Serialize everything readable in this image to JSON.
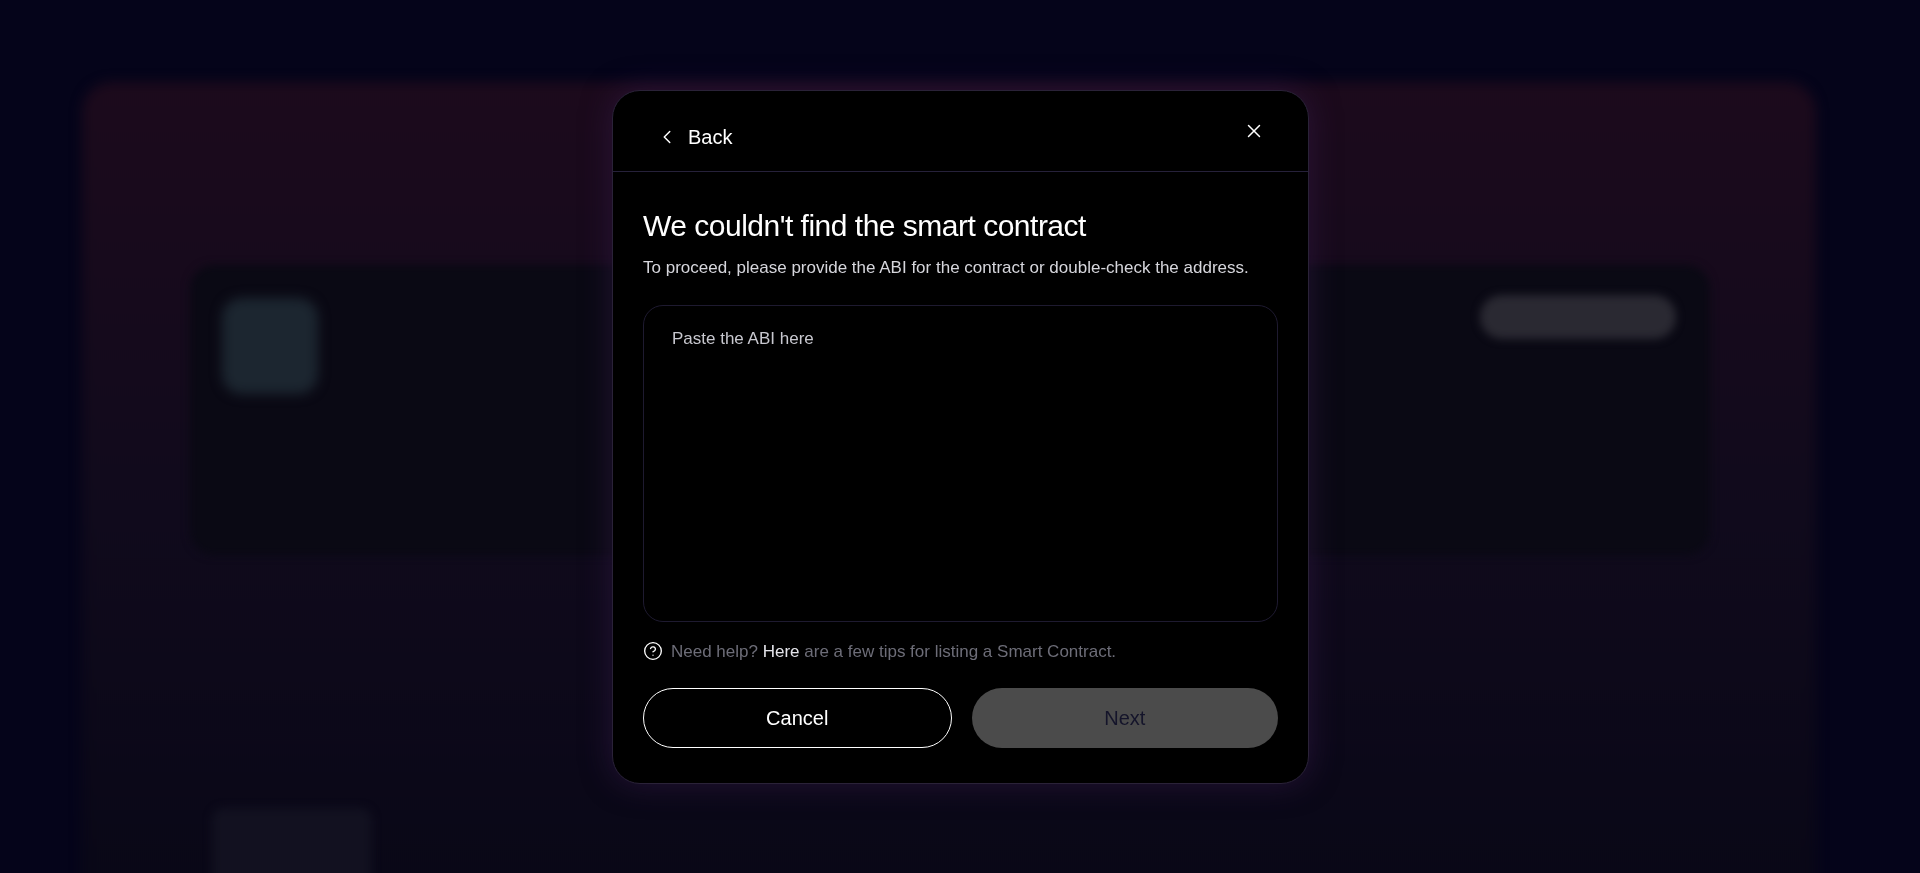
{
  "dialog": {
    "back": {
      "label": "Back"
    },
    "title": "We couldn't find the smart contract",
    "subtitle": "To proceed, please provide the ABI for the contract or double-check the address.",
    "abi_field": {
      "placeholder": "Paste the ABI here"
    },
    "help": {
      "prefix": "Need help?",
      "link": "Here",
      "suffix": "are a few tips for listing a Smart Contract."
    },
    "buttons": [
      {
        "label": "Cancel",
        "kind": "secondary",
        "disabled": false
      },
      {
        "label": "Next",
        "kind": "primary",
        "disabled": true
      }
    ]
  }
}
